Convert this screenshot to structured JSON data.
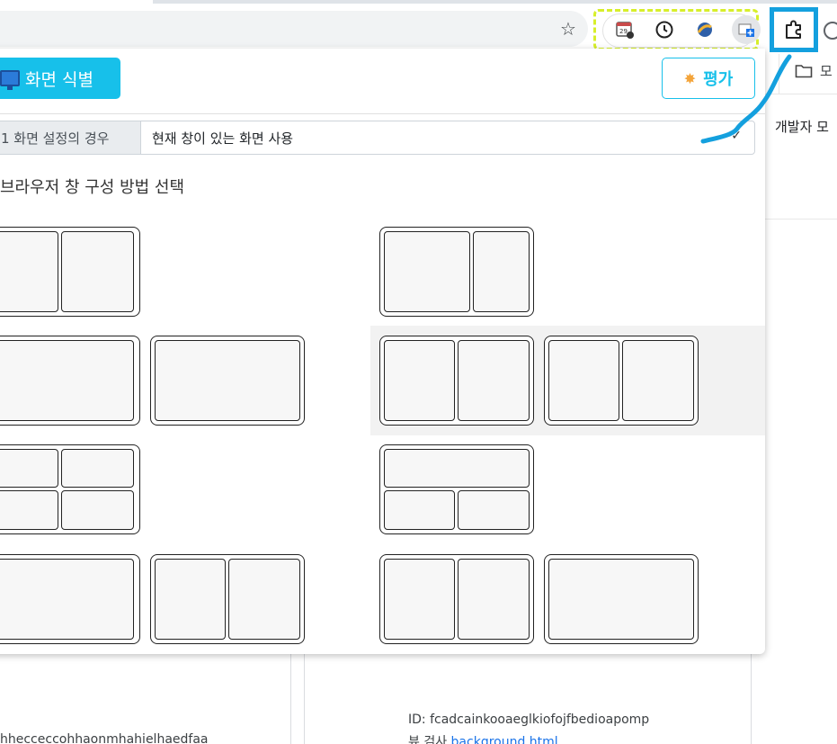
{
  "toolbar": {
    "bookmark_star": "☆",
    "extensions": [
      "calendar-icon",
      "clock-icon",
      "planet-icon",
      "window-plus-icon"
    ],
    "puzzle_icon": "puzzle-icon"
  },
  "bookmarks": {
    "folder_label": "모"
  },
  "side": {
    "dev_mode": "개발자 모"
  },
  "popup": {
    "identify_button": "화면 식별",
    "rate_button": "평가",
    "setting_label": "1 화면 설정의 경우",
    "setting_value": "현재 창이 있는 화면 사용",
    "setting_caret": "✓",
    "section_title": "브라우저 창 구성 방법 선택"
  },
  "background": {
    "id_line": "ID: fcadcainkooaeglkiofojfbedioapomp",
    "inspect_prefix": "뷰 검사",
    "inspect_link": "background.html",
    "left_text": "hhecceccohhaonmhahielhaedfaa"
  },
  "colors": {
    "accent": "#17c0ea",
    "annotation_blue": "#14a0de",
    "annotation_yellow": "#d7ef2a"
  }
}
